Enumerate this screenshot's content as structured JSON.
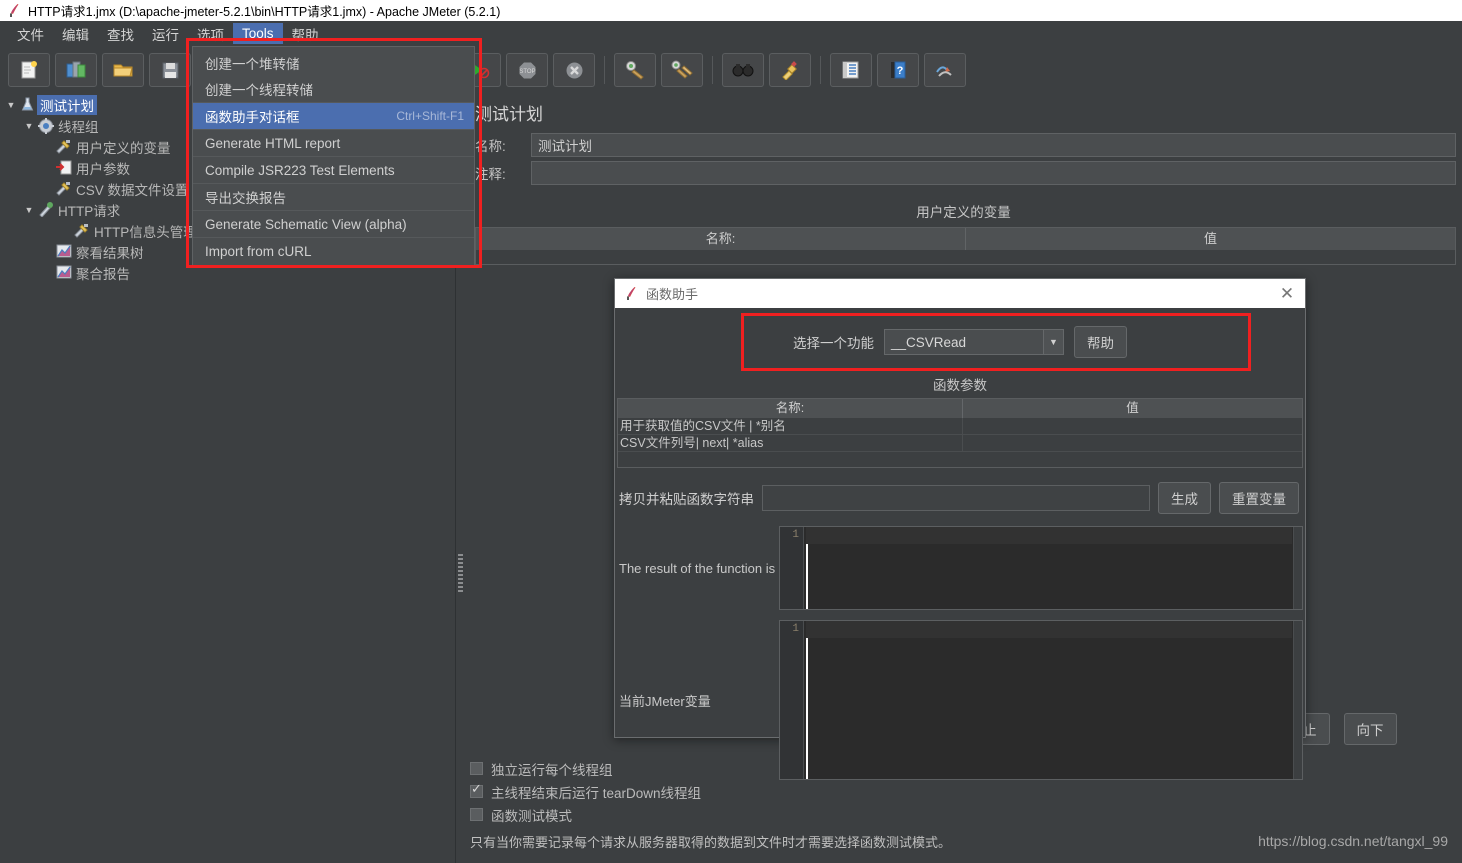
{
  "window": {
    "title": "HTTP请求1.jmx (D:\\apache-jmeter-5.2.1\\bin\\HTTP请求1.jmx) - Apache JMeter (5.2.1)",
    "app_icon": "jmeter-feather-icon"
  },
  "menubar": {
    "items": [
      {
        "label": "文件",
        "name": "menu-file",
        "active": false
      },
      {
        "label": "编辑",
        "name": "menu-edit",
        "active": false
      },
      {
        "label": "查找",
        "name": "menu-search",
        "active": false
      },
      {
        "label": "运行",
        "name": "menu-run",
        "active": false
      },
      {
        "label": "选项",
        "name": "menu-options",
        "active": false
      },
      {
        "label": "Tools",
        "name": "menu-tools",
        "active": true
      },
      {
        "label": "帮助",
        "name": "menu-help",
        "active": false
      }
    ]
  },
  "tools_menu": {
    "open": true,
    "items": [
      {
        "label": "创建一个堆转储",
        "accel": "",
        "name": "menu-item-heap-dump",
        "selected": false
      },
      {
        "label": "创建一个线程转储",
        "accel": "",
        "name": "menu-item-thread-dump",
        "selected": false
      },
      {
        "label": "函数助手对话框",
        "accel": "Ctrl+Shift-F1",
        "name": "menu-item-function-helper",
        "selected": true
      },
      {
        "label": "Generate HTML report",
        "accel": "",
        "name": "menu-item-generate-html-report",
        "selected": false
      },
      {
        "label": "Compile JSR223 Test Elements",
        "accel": "",
        "name": "menu-item-compile-jsr223",
        "selected": false
      },
      {
        "label": "导出交换报告",
        "accel": "",
        "name": "menu-item-export-transactions-report",
        "selected": false
      },
      {
        "label": "Generate Schematic View (alpha)",
        "accel": "",
        "name": "menu-item-generate-schematic-view",
        "selected": false
      },
      {
        "label": "Import from cURL",
        "accel": "",
        "name": "menu-item-import-from-curl",
        "selected": false
      }
    ]
  },
  "toolbar": {
    "buttons": [
      {
        "icon": "new-test-plan-icon",
        "name": "toolbar-new"
      },
      {
        "icon": "templates-icon",
        "name": "toolbar-templates"
      },
      {
        "icon": "open-folder-icon",
        "name": "toolbar-open"
      },
      {
        "icon": "save-icon",
        "name": "toolbar-save"
      },
      {
        "icon": "cut-icon",
        "name": "toolbar-cut"
      },
      {
        "icon": "copy-icon",
        "name": "toolbar-copy"
      },
      {
        "icon": "paste-icon",
        "name": "toolbar-paste"
      },
      {
        "icon": "expand-collapse-icon",
        "name": "toolbar-toggle"
      },
      {
        "icon": "start-icon",
        "name": "toolbar-start"
      },
      {
        "icon": "start-no-pauses-icon",
        "name": "toolbar-start-no-pauses"
      },
      {
        "icon": "stop-icon",
        "name": "toolbar-stop"
      },
      {
        "icon": "shutdown-icon",
        "name": "toolbar-shutdown"
      },
      {
        "icon": "clear-icon",
        "name": "toolbar-clear"
      },
      {
        "icon": "clear-all-icon",
        "name": "toolbar-clear-all"
      },
      {
        "icon": "search-binoculars-icon",
        "name": "toolbar-search"
      },
      {
        "icon": "reset-search-broom-icon",
        "name": "toolbar-reset-search"
      },
      {
        "icon": "function-helper-list-icon",
        "name": "toolbar-function-helper"
      },
      {
        "icon": "help-book-icon",
        "name": "toolbar-help"
      },
      {
        "icon": "undo-redo-icon",
        "name": "toolbar-extra"
      }
    ]
  },
  "tree": {
    "nodes": [
      {
        "label": "测试计划",
        "icon": "test-plan-icon",
        "indent": 0,
        "toggle": "▼",
        "selected": true,
        "name": "tree-node-test-plan"
      },
      {
        "label": "线程组",
        "icon": "thread-group-gear-icon",
        "indent": 1,
        "toggle": "▼",
        "selected": false,
        "name": "tree-node-thread-group"
      },
      {
        "label": "用户定义的变量",
        "icon": "config-element-icon",
        "indent": 2,
        "toggle": "",
        "selected": false,
        "name": "tree-node-user-defined-variables"
      },
      {
        "label": "用户参数",
        "icon": "user-parameters-icon",
        "indent": 2,
        "toggle": "",
        "selected": false,
        "name": "tree-node-user-parameters"
      },
      {
        "label": "CSV 数据文件设置",
        "icon": "config-element-icon",
        "indent": 2,
        "toggle": "",
        "selected": false,
        "name": "tree-node-csv-data-set-config"
      },
      {
        "label": "HTTP请求",
        "icon": "http-sampler-icon",
        "indent": 2,
        "toggle": "▼",
        "selected": false,
        "name": "tree-node-http-request"
      },
      {
        "label": "HTTP信息头管理器",
        "icon": "config-element-icon",
        "indent": 3,
        "toggle": "",
        "selected": false,
        "name": "tree-node-http-header-manager"
      },
      {
        "label": "察看结果树",
        "icon": "listener-icon",
        "indent": 2,
        "toggle": "",
        "selected": false,
        "name": "tree-node-view-results-tree"
      },
      {
        "label": "聚合报告",
        "icon": "listener-icon",
        "indent": 2,
        "toggle": "",
        "selected": false,
        "name": "tree-node-aggregate-report"
      }
    ]
  },
  "test_plan_panel": {
    "title": "测试计划",
    "name_label": "名称:",
    "name_value": "测试计划",
    "comment_label": "注释:",
    "comment_value": "",
    "udv_title": "用户定义的变量",
    "udv_columns": [
      "名称:",
      "值"
    ],
    "checkboxes": [
      {
        "label": "独立运行每个线程组",
        "checked": false,
        "name": "checkbox-run-thread-groups-serially"
      },
      {
        "label": "主线程结束后运行 tearDown线程组",
        "checked": true,
        "name": "checkbox-run-teardown-after-shutdown"
      },
      {
        "label": "函数测试模式",
        "checked": false,
        "name": "checkbox-functional-test-mode"
      }
    ],
    "note": "只有当你需要记录每个请求从服务器取得的数据到文件时才需要选择函数测试模式。",
    "buttons": [
      {
        "label": "止",
        "name": "button-delete-partial"
      },
      {
        "label": "向下",
        "name": "button-move-down"
      }
    ]
  },
  "function_helper_dialog": {
    "title": "函数助手",
    "icon": "jmeter-feather-icon",
    "close_icon": "close-icon",
    "select_function_label": "选择一个功能",
    "selected_function": "__CSVRead",
    "help_button": "帮助",
    "params_title": "函数参数",
    "params_columns": [
      "名称:",
      "值"
    ],
    "params_rows": [
      {
        "name": "用于获取值的CSV文件 | *别名",
        "value": ""
      },
      {
        "name": "CSV文件列号| next| *alias",
        "value": ""
      }
    ],
    "copy_paste_label": "拷贝并粘贴函数字符串",
    "copy_paste_value": "",
    "generate_button": "生成",
    "reset_button": "重置变量",
    "result_label": "The result of the function is",
    "result_value": "",
    "result_line_number": "1",
    "vars_label": "当前JMeter变量",
    "vars_value": "",
    "vars_line_number": "1"
  },
  "watermark": "https://blog.csdn.net/tangxl_99",
  "colors": {
    "background": "#3c3f41",
    "panel": "#4a4d4f",
    "accent_blue": "#4b6eaf",
    "highlight_red": "#f02020",
    "text": "#bbbbbb",
    "titlebar": "#ffffff",
    "code_bg": "#2b2b2b"
  }
}
